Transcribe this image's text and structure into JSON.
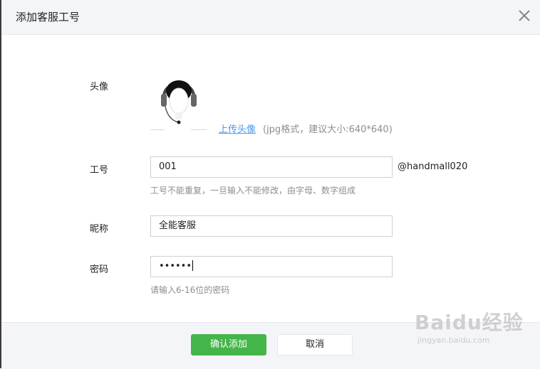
{
  "dialog": {
    "title": "添加客服工号"
  },
  "avatar": {
    "label": "头像",
    "upload_link": "上传头像",
    "upload_hint": "(jpg格式，建议大小:640*640)"
  },
  "account_id": {
    "label": "工号",
    "value": "001",
    "suffix": "@handmall020",
    "tip": "工号不能重复，一旦输入不能修改，由字母、数字组成"
  },
  "nickname": {
    "label": "昵称",
    "value": "全能客服"
  },
  "password": {
    "label": "密码",
    "value": "••••••",
    "tip": "请输入6-16位的密码"
  },
  "buttons": {
    "confirm": "确认添加",
    "cancel": "取消"
  },
  "watermark": {
    "brand": "Baidu经验",
    "url": "jingyan.baidu.com"
  },
  "colors": {
    "confirm_button": "#44b549",
    "link": "#459ae9",
    "header_bg": "#f4f5f9"
  }
}
